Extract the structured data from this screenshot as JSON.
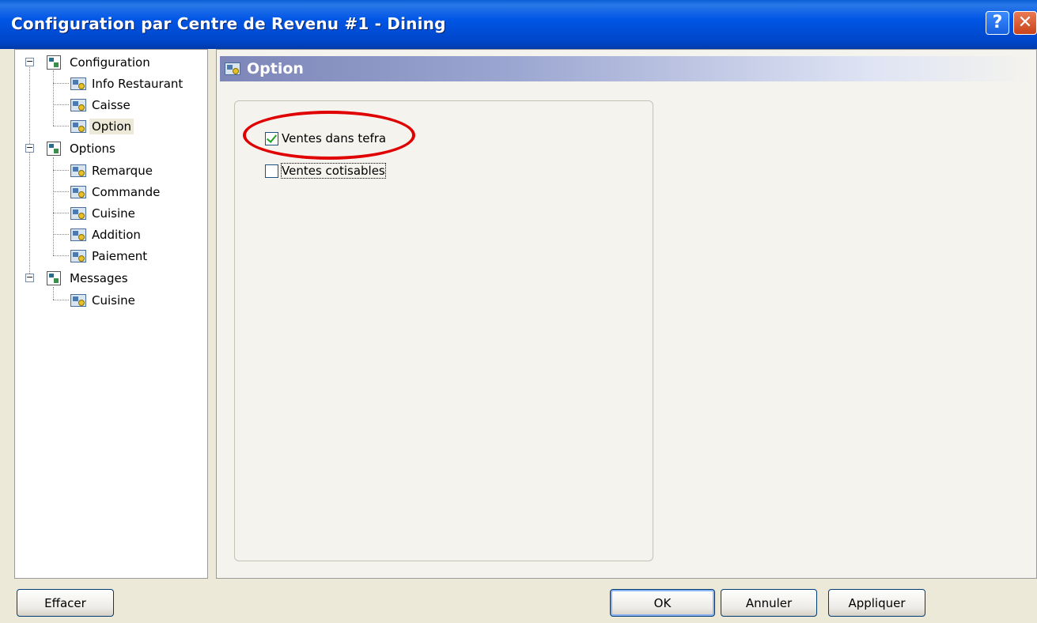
{
  "window": {
    "title": "Configuration par Centre de Revenu #1 - Dining",
    "help_label": "?",
    "close_label": "✕"
  },
  "tree": {
    "groups": [
      {
        "label": "Configuration",
        "expander": "−",
        "children": [
          "Info Restaurant",
          "Caisse",
          "Option"
        ]
      },
      {
        "label": "Options",
        "expander": "−",
        "children": [
          "Remarque",
          "Commande",
          "Cuisine",
          "Addition",
          "Paiement"
        ]
      },
      {
        "label": "Messages",
        "expander": "−",
        "children": [
          "Cuisine"
        ]
      }
    ],
    "selected": "Option"
  },
  "panel": {
    "title": "Option",
    "checkboxes": [
      {
        "label": "Ventes dans tefra",
        "checked": true
      },
      {
        "label": "Ventes cotisables",
        "checked": false
      }
    ]
  },
  "buttons": {
    "clear": "Effacer",
    "ok": "OK",
    "cancel": "Annuler",
    "apply": "Appliquer"
  },
  "colors": {
    "titlebar": "#0055e5",
    "highlight_ellipse": "#e00000",
    "check_mark": "#21a121"
  }
}
